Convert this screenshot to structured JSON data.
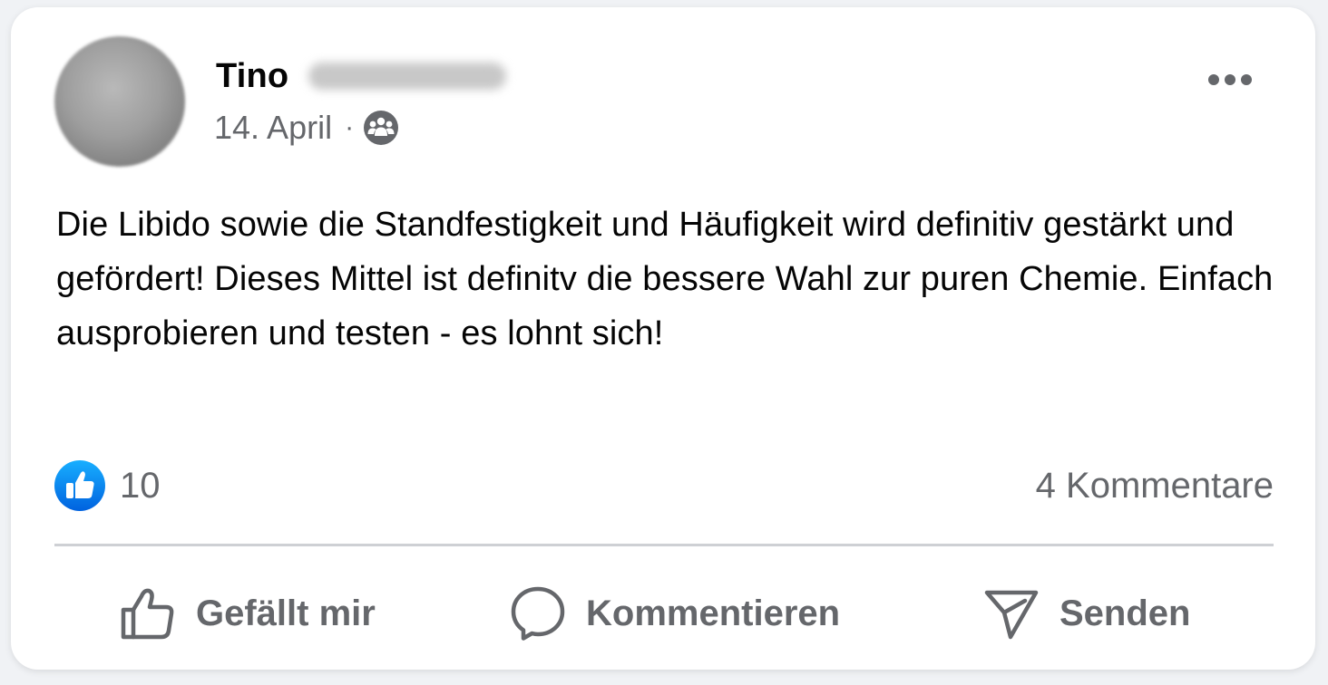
{
  "post": {
    "author_first_name": "Tino",
    "date": "14. April",
    "separator": "·",
    "audience_icon": "group-audience-icon",
    "text": "Die Libido sowie die Standfestigkeit und Häufigkeit wird definitiv gestärkt und gefördert! Dieses Mittel ist definitv die bessere Wahl zur puren Chemie. Einfach ausprobieren und testen - es lohnt sich!"
  },
  "stats": {
    "like_icon": "like-reaction-icon",
    "like_count": "10",
    "comments": "4 Kommentare"
  },
  "actions": {
    "like_label": "Gefällt mir",
    "comment_label": "Kommentieren",
    "send_label": "Senden"
  },
  "colors": {
    "text_primary": "#050505",
    "text_secondary": "#65676b",
    "like_blue": "#1877f2",
    "divider": "#ced0d4"
  }
}
